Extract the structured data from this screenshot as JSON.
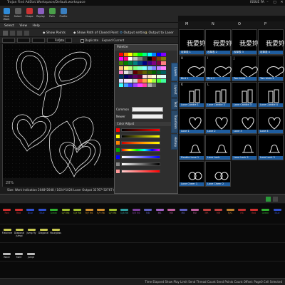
{
  "window": {
    "title": "Trojan Find AdEtst.Workspace/Default.workspace",
    "edition": "ISSUE FA"
  },
  "toolbar": {
    "buttons": [
      "New Work",
      "Select",
      "Shape",
      "Replay",
      "Path",
      "Profile"
    ]
  },
  "menu": [
    "Select",
    "View",
    "Help"
  ],
  "commands": {
    "show_points": "Show Points",
    "show_path": "Show Path of Closed Point",
    "output_setting": "Output setting",
    "output_to_laser": "Output to Laser"
  },
  "transform": {
    "rotate_label": "Rotate",
    "duplicate_label": "Duplicate",
    "expand_label": "Expand Current"
  },
  "canvas": {
    "zoom": "20%",
    "status": "Size: Work Indication 2048*2048 / 1024*1024 Laser Output 32767*32767 (Scale: 1:32)"
  },
  "palette": {
    "title": "Palette",
    "common_label": "Common",
    "newer_label": "Newer",
    "adjust_title": "Color Adjust",
    "ok": "OK",
    "cancel": "Cancel",
    "colors": [
      "#ff0000",
      "#ff8000",
      "#ffff00",
      "#80ff00",
      "#00ff00",
      "#00ff80",
      "#00ffff",
      "#0080ff",
      "#0000ff",
      "#8000ff",
      "#ff00ff",
      "#ff0080",
      "#ffffff",
      "#c0c0c0",
      "#808080",
      "#404040",
      "#000000",
      "#800000",
      "#804000",
      "#808000",
      "#408000",
      "#008000",
      "#008040",
      "#008080",
      "#004080",
      "#000080",
      "#400080",
      "#800080",
      "#800040",
      "#ff8080",
      "#ffc080",
      "#ffff80",
      "#c0ff80",
      "#80ff80",
      "#80ffc0",
      "#80ffff",
      "#80c0ff",
      "#8080ff",
      "#c080ff",
      "#ff80ff",
      "#ff80c0",
      "#e0e0e0",
      "#a0a0a0",
      "#600000",
      "#603000",
      "#606000",
      "#306000",
      "#006000",
      "#006030",
      "#006060",
      "#003060",
      "#000060",
      "#300060",
      "#600060",
      "#600030",
      "#ffe0e0",
      "#ffe0c0",
      "#ffffe0",
      "#e0ffe0",
      "#e0ffff",
      "#e0e0ff",
      "#ffe0ff",
      "#f0f0f0",
      "#d0d0d0",
      "#ff4040",
      "#ffa040",
      "#ffff40",
      "#a0ff40",
      "#40ff40",
      "#40ffa0",
      "#40ffff",
      "#40a0ff",
      "#4040ff",
      "#a040ff",
      "#ff40ff",
      "#ff40a0",
      "#b0b0b0",
      "#707070"
    ]
  },
  "side_tabs": [
    "Layers",
    "Layout",
    "Text",
    "Transform",
    "History"
  ],
  "layers_panel": {
    "headers": [
      "M",
      "N",
      "O",
      "P"
    ],
    "cells": [
      {
        "letter": "",
        "label": "攻擊表 1"
      },
      {
        "letter": "",
        "label": "攻擊表 2"
      },
      {
        "letter": "",
        "label": "攻擊表 3"
      },
      {
        "letter": "",
        "label": "攻擊表 4"
      },
      {
        "letter": "H",
        "label": "Bird 1"
      },
      {
        "letter": "I",
        "label": "Bird 2"
      },
      {
        "letter": "J",
        "label": "Two birds"
      },
      {
        "letter": "",
        "label": "Two birds 2"
      },
      {
        "letter": "K",
        "label": "Love Candle 1"
      },
      {
        "letter": "L",
        "label": "Love Candle 2"
      },
      {
        "letter": "",
        "label": "Love Candle 3"
      },
      {
        "letter": "",
        "label": "Love Candle 4"
      },
      {
        "letter": "",
        "label": "Love 1"
      },
      {
        "letter": "",
        "label": "Love 2"
      },
      {
        "letter": "",
        "label": "Love 3"
      },
      {
        "letter": "",
        "label": "Love 4"
      },
      {
        "letter": "",
        "label": "Double Love 1"
      },
      {
        "letter": "",
        "label": "Love Lock"
      },
      {
        "letter": "",
        "label": "Love Lock 2"
      },
      {
        "letter": "",
        "label": "Love Lock 3"
      },
      {
        "letter": "",
        "label": "Love Cheer 1"
      },
      {
        "letter": "",
        "label": "Love Cheer 2"
      }
    ]
  },
  "bottom_layers": {
    "row1": [
      {
        "name": "Red",
        "color": "#d03030"
      },
      {
        "name": "Red",
        "color": "#d03030"
      },
      {
        "name": "Blue",
        "color": "#3050d0"
      },
      {
        "name": "Blue",
        "color": "#3050d0"
      },
      {
        "name": "Green",
        "color": "#30b030"
      },
      {
        "name": "G/Y R6",
        "color": "#a0c030"
      },
      {
        "name": "G/Y R6",
        "color": "#a0c030"
      },
      {
        "name": "R/Y R6",
        "color": "#d09030"
      },
      {
        "name": "R/Y R6",
        "color": "#d09030"
      },
      {
        "name": "G/Y R6",
        "color": "#a0c030"
      },
      {
        "name": "G/B R6",
        "color": "#30a0a0"
      },
      {
        "name": "B/R R6",
        "color": "#8040a0"
      },
      {
        "name": "MB",
        "color": "#6060c0"
      },
      {
        "name": "MS",
        "color": "#a060c0"
      },
      {
        "name": "MV",
        "color": "#c060a0"
      },
      {
        "name": "MB",
        "color": "#6060c0"
      },
      {
        "name": "MV",
        "color": "#c060a0"
      },
      {
        "name": "MR",
        "color": "#c04040"
      },
      {
        "name": "MR",
        "color": "#c04040"
      },
      {
        "name": "R/G",
        "color": "#c08030"
      },
      {
        "name": "R6",
        "color": "#c03030"
      },
      {
        "name": "Red",
        "color": "#d03030"
      },
      {
        "name": "Green",
        "color": "#30b030"
      },
      {
        "name": "Blue",
        "color": "#3050d0"
      }
    ],
    "row2": [
      "Flatcircle",
      "Diagonal Jumpi",
      "Jump fly",
      "Diagonal",
      "Hourglass"
    ],
    "row3": [
      "Wave",
      "Swirl",
      "Jumpl"
    ]
  },
  "statusbar": "Time Elapsed Show Play Limit Send Thread Count Send Points Count Offset: Page0 Cell Selected"
}
